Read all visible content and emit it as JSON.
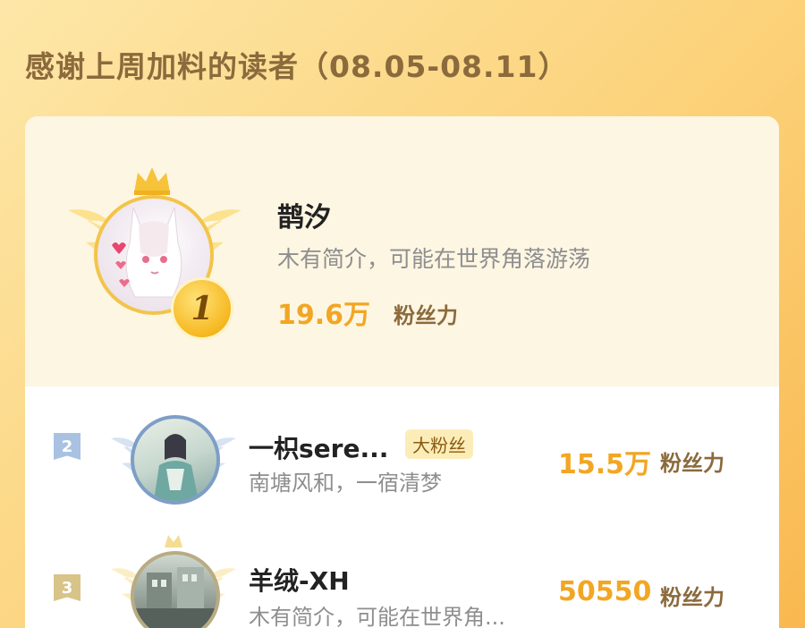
{
  "header": {
    "title": "感谢上周加料的读者（08.05-08.11）"
  },
  "colors": {
    "accent": "#f2a623",
    "label": "#8b6a3c",
    "gold": "#f3c44a",
    "silver": "#7e9ec7"
  },
  "top_reader": {
    "rank": "1",
    "name": "鹊汐",
    "bio": "木有简介，可能在世界角落游荡",
    "fans_value": "19.6万",
    "fans_label": "粉丝力",
    "icons": [
      "crown-icon",
      "wings-icon",
      "heart-icon"
    ]
  },
  "readers": [
    {
      "rank": "2",
      "name": "一枳sere...",
      "tag": "大粉丝",
      "bio": "南塘风和，一宿清梦",
      "fans_value": "15.5万",
      "fans_label": "粉丝力"
    },
    {
      "rank": "3",
      "name": "羊绒-XH",
      "tag": "",
      "bio": "木有简介，可能在世界角...",
      "fans_value": "50550",
      "fans_label": "粉丝力"
    }
  ]
}
